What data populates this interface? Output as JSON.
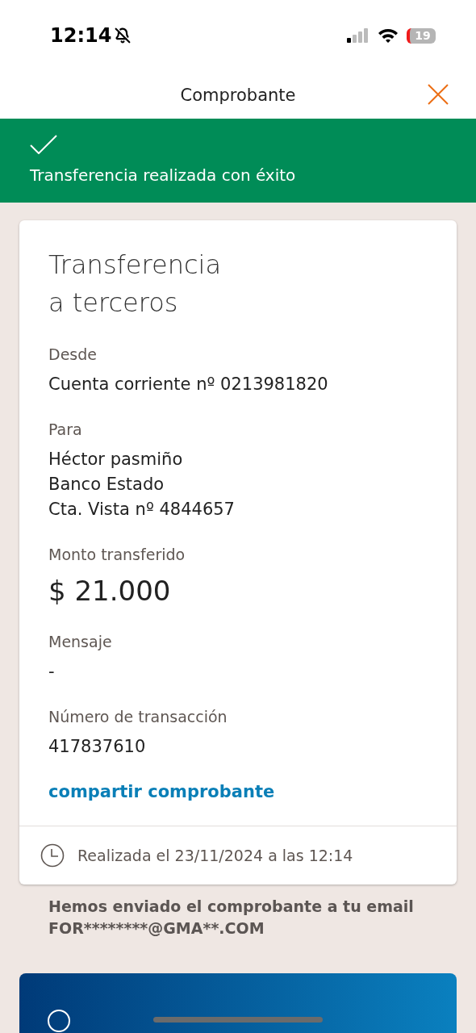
{
  "status_bar": {
    "time": "12:14",
    "battery": "19"
  },
  "header": {
    "title": "Comprobante"
  },
  "banner": {
    "message": "Transferencia realizada con éxito"
  },
  "receipt": {
    "title": "Transferencia\na terceros",
    "fields": [
      {
        "kind": "text",
        "label": "Desde",
        "lines": [
          "Cuenta corriente nº 0213981820"
        ]
      },
      {
        "kind": "text",
        "label": "Para",
        "lines": [
          "Héctor pasmiño",
          "Banco Estado",
          "Cta. Vista nº 4844657"
        ]
      },
      {
        "kind": "amount",
        "label": "Monto transferido",
        "lines": [
          "$ 21.000"
        ]
      },
      {
        "kind": "text",
        "label": "Mensaje",
        "lines": [
          "-"
        ]
      },
      {
        "kind": "text",
        "label": "Número de transacción",
        "lines": [
          "417837610"
        ]
      }
    ],
    "share_link": "compartir comprobante",
    "footer": "Realizada el 23/11/2024 a las 12:14"
  },
  "email_notice": [
    "Hemos enviado el comprobante a tu email",
    "FOR********@GMA**.COM"
  ]
}
